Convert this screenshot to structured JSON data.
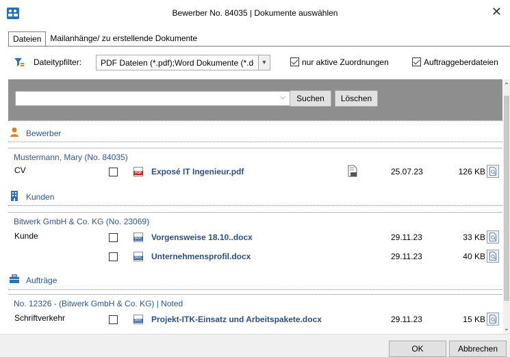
{
  "window": {
    "title": "Bewerber No. 84035 | Dokumente auswählen",
    "close_glyph": "✕"
  },
  "tabs": [
    {
      "label": "Dateien",
      "active": true
    },
    {
      "label": "Mailanhänge/ zu erstellende Dokumente",
      "active": false
    }
  ],
  "filter": {
    "label": "Dateitypfilter:",
    "select_value": "PDF Dateien (*.pdf);Word Dokumente (*.doc",
    "only_active_label": "nur aktive Zuordnungen",
    "only_active_checked": true,
    "client_files_label": "Auftraggeberdateien",
    "client_files_checked": true
  },
  "search": {
    "value": "",
    "search_button": "Suchen",
    "clear_button": "Löschen"
  },
  "sections": {
    "applicant": {
      "title": "Bewerber",
      "group": "Mustermann, Mary (No. 84035)",
      "rows": [
        {
          "category": "CV",
          "icon": "pdf-icon",
          "icon_text": "PDF",
          "name": "Exposé IT Ingenieur.pdf",
          "date": "25.07.23",
          "size": "126 KB",
          "export_icon": "export-icon"
        }
      ]
    },
    "customers": {
      "title": "Kunden",
      "group": "Bitwerk GmbH & Co. KG  (No. 23069)",
      "rows": [
        {
          "category": "Kunde",
          "icon": "doc-icon",
          "icon_text": "DOC",
          "name": "Vorgensweise 18.10..docx",
          "date": "29.11.23",
          "size": "33 KB"
        },
        {
          "category": "",
          "icon": "doc-icon",
          "icon_text": "DOC",
          "name": "Unternehmensprofil.docx",
          "date": "29.11.23",
          "size": "40 KB"
        }
      ]
    },
    "orders": {
      "title": "Aufträge",
      "group": "No. 12326 -  (Bitwerk GmbH & Co. KG) | Noted",
      "rows": [
        {
          "category": "Schriftverkehr",
          "icon": "doc-icon",
          "icon_text": "DOC",
          "name": "Projekt-ITK-Einsatz und Arbeitspakete.docx",
          "date": "29.11.23",
          "size": "15 KB"
        }
      ]
    }
  },
  "footer": {
    "ok_label": "OK",
    "cancel_label": "Abbrechen"
  },
  "colors": {
    "link_blue": "#2b4f85",
    "section_blue": "#2b5797",
    "search_panel": "#8e8e8e",
    "pdf_red": "#d0201b",
    "doc_blue": "#2f5fa8"
  }
}
